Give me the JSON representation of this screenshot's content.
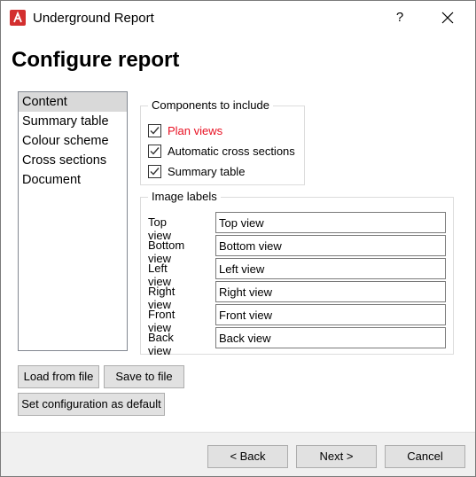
{
  "window": {
    "title": "Underground Report",
    "help_label": "?",
    "icons": {
      "app": "app-logo-icon",
      "close": "close-icon"
    }
  },
  "header": {
    "title": "Configure report"
  },
  "nav": {
    "items": [
      {
        "label": "Content",
        "selected": true
      },
      {
        "label": "Summary table"
      },
      {
        "label": "Colour scheme"
      },
      {
        "label": "Cross sections"
      },
      {
        "label": "Document"
      }
    ]
  },
  "components": {
    "legend": "Components to include",
    "options": [
      {
        "label": "Plan views",
        "checked": true,
        "highlight_color": "#e81123"
      },
      {
        "label": "Automatic cross sections",
        "checked": true
      },
      {
        "label": "Summary table",
        "checked": true
      }
    ]
  },
  "image_labels": {
    "legend": "Image labels",
    "rows": [
      {
        "label": "Top view",
        "value": "Top view"
      },
      {
        "label": "Bottom view",
        "value": "Bottom view"
      },
      {
        "label": "Left view",
        "value": "Left view"
      },
      {
        "label": "Right view",
        "value": "Right view"
      },
      {
        "label": "Front view",
        "value": "Front view"
      },
      {
        "label": "Back view",
        "value": "Back view"
      }
    ]
  },
  "actions": {
    "load": "Load from file",
    "save": "Save to file",
    "set_default": "Set configuration as default"
  },
  "footer": {
    "back": "< Back",
    "next": "Next >",
    "cancel": "Cancel"
  }
}
